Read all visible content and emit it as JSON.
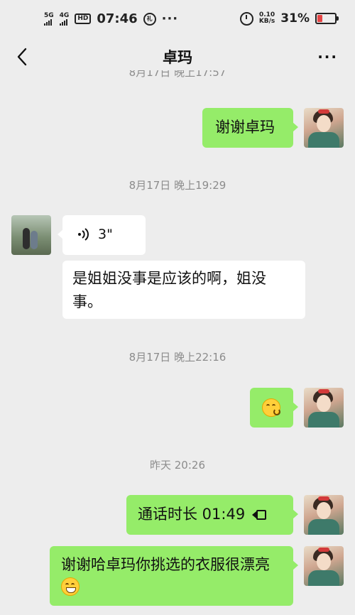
{
  "status_bar": {
    "network_1": "5G",
    "network_2": "4G",
    "hd_label": "HD",
    "time": "07:46",
    "carrier_badge": "礼",
    "overflow": "···",
    "speed_value": "0.10",
    "speed_unit": "KB/s",
    "battery_percent": "31%",
    "battery_level": 0.31,
    "battery_color": "#e54545"
  },
  "nav": {
    "title": "卓玛",
    "more": "···"
  },
  "chat": {
    "cutoff_timestamp": "8月17日 晚上17:57",
    "messages": [
      {
        "side": "out",
        "text": "谢谢卓玛"
      },
      {
        "timestamp": "8月17日 晚上19:29"
      },
      {
        "side": "in",
        "voice_duration": "3\""
      },
      {
        "side": "in",
        "text": "是姐姐没事是应该的啊，姐没事。"
      },
      {
        "timestamp": "8月17日 晚上22:16"
      },
      {
        "side": "out",
        "emoji": "smiling-face-emoji"
      },
      {
        "timestamp": "昨天 20:26"
      },
      {
        "side": "out",
        "text": "通话时长 01:49",
        "icon": "video-call-icon"
      },
      {
        "side": "out",
        "text": "谢谢哈卓玛你挑选的衣服很漂亮",
        "emoji": "grinning-face-emoji"
      }
    ]
  },
  "colors": {
    "background": "#ededed",
    "outgoing_bubble": "#95ec69",
    "incoming_bubble": "#ffffff",
    "timestamp_text": "#8c8c8c"
  }
}
